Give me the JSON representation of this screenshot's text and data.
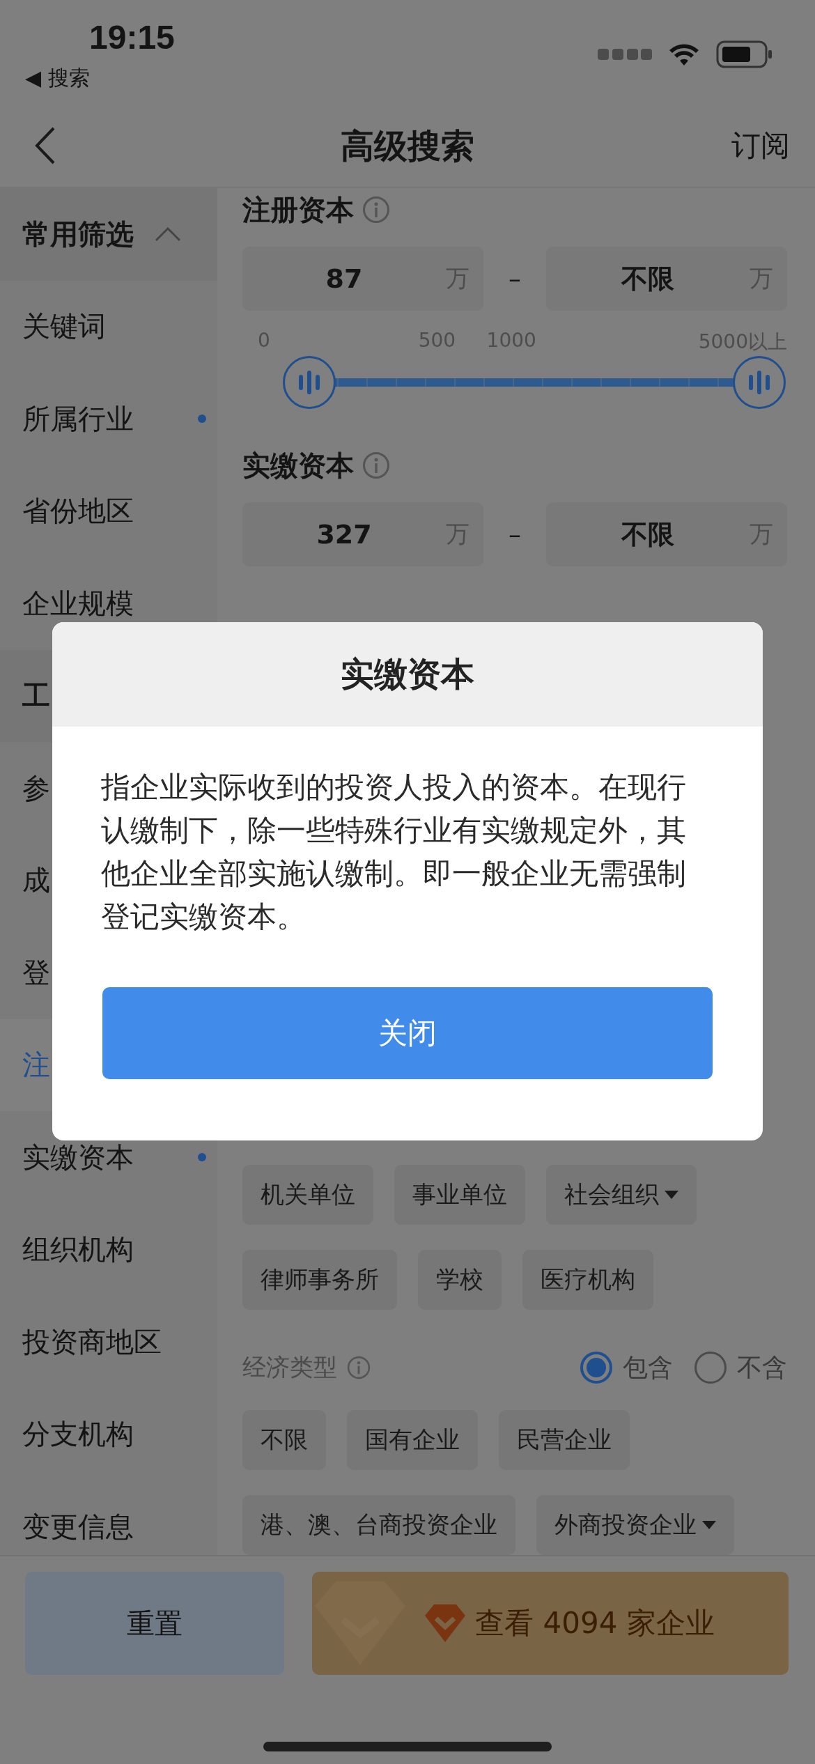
{
  "status_bar": {
    "time": "19:15",
    "back_label": "◀ 搜索"
  },
  "nav": {
    "title": "高级搜索",
    "action": "订阅"
  },
  "sidebar": {
    "items": [
      {
        "label": "常用筛选",
        "kind": "group",
        "expanded": true,
        "selected": false,
        "marked": false
      },
      {
        "label": "关键词",
        "kind": "item",
        "selected": false,
        "marked": false
      },
      {
        "label": "所属行业",
        "kind": "item",
        "selected": false,
        "marked": true
      },
      {
        "label": "省份地区",
        "kind": "item",
        "selected": false,
        "marked": false
      },
      {
        "label": "企业规模",
        "kind": "item",
        "selected": false,
        "marked": false
      },
      {
        "label": "工",
        "kind": "group",
        "selected": false,
        "marked": false
      },
      {
        "label": "参",
        "kind": "item",
        "selected": false,
        "marked": false
      },
      {
        "label": "成",
        "kind": "item",
        "selected": false,
        "marked": false
      },
      {
        "label": "登",
        "kind": "item",
        "selected": false,
        "marked": false
      },
      {
        "label": "注",
        "kind": "item",
        "selected": true,
        "marked": false
      },
      {
        "label": "实缴资本",
        "kind": "item",
        "selected": false,
        "marked": true
      },
      {
        "label": "组织机构",
        "kind": "item",
        "selected": false,
        "marked": false
      },
      {
        "label": "投资商地区",
        "kind": "item",
        "selected": false,
        "marked": false
      },
      {
        "label": "分支机构",
        "kind": "item",
        "selected": false,
        "marked": false
      },
      {
        "label": "变更信息",
        "kind": "item",
        "selected": false,
        "marked": false
      }
    ]
  },
  "registered_capital": {
    "title": "注册资本",
    "min": "87",
    "max": "不限",
    "unit_min": "万",
    "unit_max": "万",
    "separator": "–",
    "ticks": [
      "0",
      "500",
      "1000",
      "5000以上"
    ],
    "thumbs": [
      {
        "level": 0.09
      },
      {
        "level": 1.0
      }
    ]
  },
  "paid_capital": {
    "title": "实缴资本",
    "min": "327",
    "max": "不限",
    "unit_min": "万",
    "unit_max": "万",
    "separator": "–"
  },
  "org_chips": [
    [
      {
        "label": "机关单位",
        "dropdown": false
      },
      {
        "label": "事业单位",
        "dropdown": false
      },
      {
        "label": "社会组织",
        "dropdown": true
      }
    ],
    [
      {
        "label": "律师事务所",
        "dropdown": false
      },
      {
        "label": "学校",
        "dropdown": false
      },
      {
        "label": "医疗机构",
        "dropdown": false
      }
    ]
  ],
  "economic_type": {
    "title": "经济类型",
    "options": [
      {
        "label": "包含",
        "selected": true
      },
      {
        "label": "不含",
        "selected": false
      }
    ],
    "chips": [
      [
        {
          "label": "不限",
          "dropdown": false
        },
        {
          "label": "国有企业",
          "dropdown": false
        },
        {
          "label": "民营企业",
          "dropdown": false
        }
      ],
      [
        {
          "label": "港、澳、台商投资企业",
          "dropdown": false
        },
        {
          "label": "外商投资企业",
          "dropdown": true
        }
      ]
    ]
  },
  "bottom_bar": {
    "reset": "重置",
    "view": "查看 4094 家企业"
  },
  "dialog": {
    "title": "实缴资本",
    "body": "指企业实际收到的投资人投入的资本。在现行认缴制下，除一些特殊行业有实缴规定外，其他企业全部实施认缴制。即一般企业无需强制登记实缴资本。",
    "button": "关闭"
  }
}
